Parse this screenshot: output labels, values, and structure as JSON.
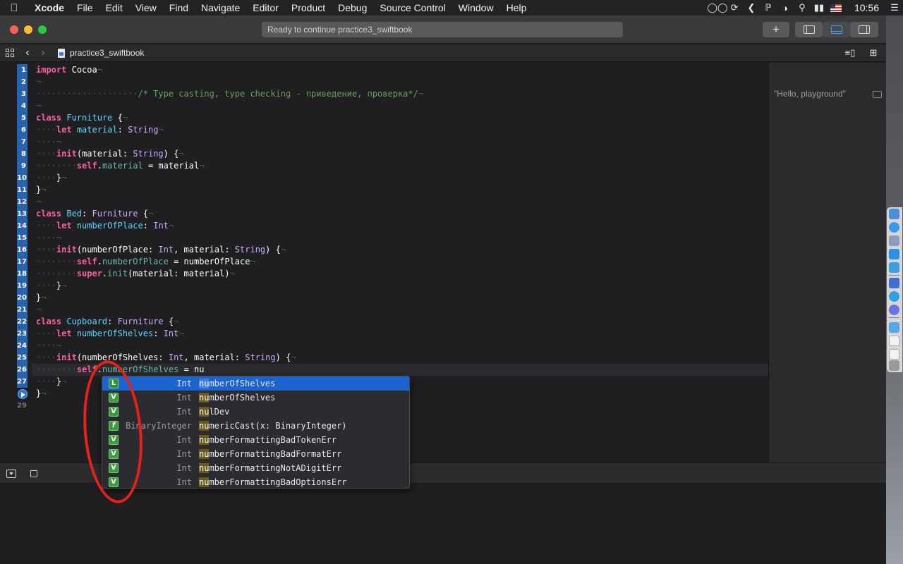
{
  "menubar": {
    "app_name": "Xcode",
    "items": [
      "File",
      "Edit",
      "View",
      "Find",
      "Navigate",
      "Editor",
      "Product",
      "Debug",
      "Source Control",
      "Window",
      "Help"
    ],
    "status_icons": [
      "glasses-icon",
      "sync-icon",
      "flutter-icon",
      "bluetooth-icon",
      "wifi-icon",
      "search-icon",
      "battery-icon",
      "us-flag-icon",
      "menu-list-icon"
    ],
    "clock": "10:56"
  },
  "toolbar": {
    "activity_text": "Ready to continue practice3_swiftbook",
    "add_label": "+"
  },
  "jumpbar": {
    "filename": "practice3_swiftbook"
  },
  "editor": {
    "line_numbers": [
      "1",
      "2",
      "3",
      "4",
      "5",
      "6",
      "7",
      "8",
      "9",
      "10",
      "11",
      "12",
      "13",
      "14",
      "15",
      "16",
      "17",
      "18",
      "19",
      "20",
      "21",
      "22",
      "23",
      "24",
      "25",
      "26",
      "27",
      "",
      "29"
    ],
    "comment_text": "/* Type casting, type checking - приведение, проверка*/",
    "current_line_text": "nu"
  },
  "results": {
    "value": "\"Hello, playground\""
  },
  "completion": {
    "typed_prefix": "nu",
    "items": [
      {
        "badge": "L",
        "type": "Int",
        "prefix": "nu",
        "rest": "mberOfShelves",
        "selected": true
      },
      {
        "badge": "V",
        "type": "Int",
        "prefix": "nu",
        "rest": "mberOfShelves",
        "selected": false
      },
      {
        "badge": "V",
        "type": "Int",
        "prefix": "nu",
        "rest": "lDev",
        "selected": false
      },
      {
        "badge": "f",
        "type": "BinaryInteger",
        "prefix": "nu",
        "rest": "mericCast(x: BinaryInteger)",
        "selected": false
      },
      {
        "badge": "V",
        "type": "Int",
        "prefix": "nu",
        "rest": "mberFormattingBadTokenErr",
        "selected": false
      },
      {
        "badge": "V",
        "type": "Int",
        "prefix": "nu",
        "rest": "mberFormattingBadFormatErr",
        "selected": false
      },
      {
        "badge": "V",
        "type": "Int",
        "prefix": "nu",
        "rest": "mberFormattingNotADigitErr",
        "selected": false
      },
      {
        "badge": "V",
        "type": "Int",
        "prefix": "nu",
        "rest": "mberFormattingBadOptionsErr",
        "selected": false
      }
    ]
  },
  "colors": {
    "keyword": "#fc5fa3",
    "type_decl": "#5dd8ff",
    "type_ref": "#d0a8ff",
    "property": "#67b7a4",
    "comment": "#6c9f5a",
    "selection": "#1b64cf",
    "annotation": "#e8201a"
  }
}
